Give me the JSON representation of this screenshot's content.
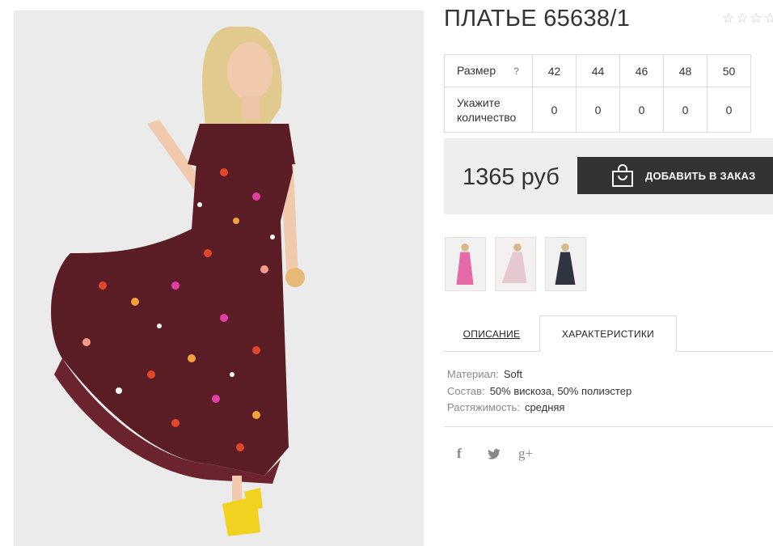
{
  "product": {
    "title": "ПЛАТЬЕ 65638/1",
    "rating_stars": 5,
    "rating_filled": 0
  },
  "sizes_table": {
    "size_label": "Размер",
    "help_icon": "?",
    "quantity_label": "Укажите количество",
    "sizes": [
      "42",
      "44",
      "46",
      "48",
      "50"
    ],
    "quantities": [
      "0",
      "0",
      "0",
      "0",
      "0"
    ]
  },
  "purchase": {
    "price": "1365 руб",
    "order_button": "ДОБАВИТЬ В ЗАКАЗ",
    "order_icon": "shopping-bag-icon"
  },
  "thumbnails": [
    {
      "name": "pink-dress-thumbnail",
      "color": "#e76aa8"
    },
    {
      "name": "light-dress-thumbnail",
      "color": "#e6c9cf"
    },
    {
      "name": "dark-dress-thumbnail",
      "color": "#2e3540"
    }
  ],
  "tabs": {
    "description": "ОПИСАНИЕ",
    "characteristics": "ХАРАКТЕРИСТИКИ",
    "active": "characteristics"
  },
  "specs": [
    {
      "key": "Материал:",
      "value": "Soft"
    },
    {
      "key": "Состав:",
      "value": "50% вискоза, 50% полиэстер"
    },
    {
      "key": "Растяжимость:",
      "value": "средняя"
    }
  ],
  "social": {
    "facebook": "f",
    "twitter": "twitter-icon",
    "googleplus": "g+"
  },
  "colors": {
    "dress": "#5a1d26",
    "button": "#333333",
    "price_bg": "#eeeeee",
    "shoes": "#f1d21e"
  }
}
